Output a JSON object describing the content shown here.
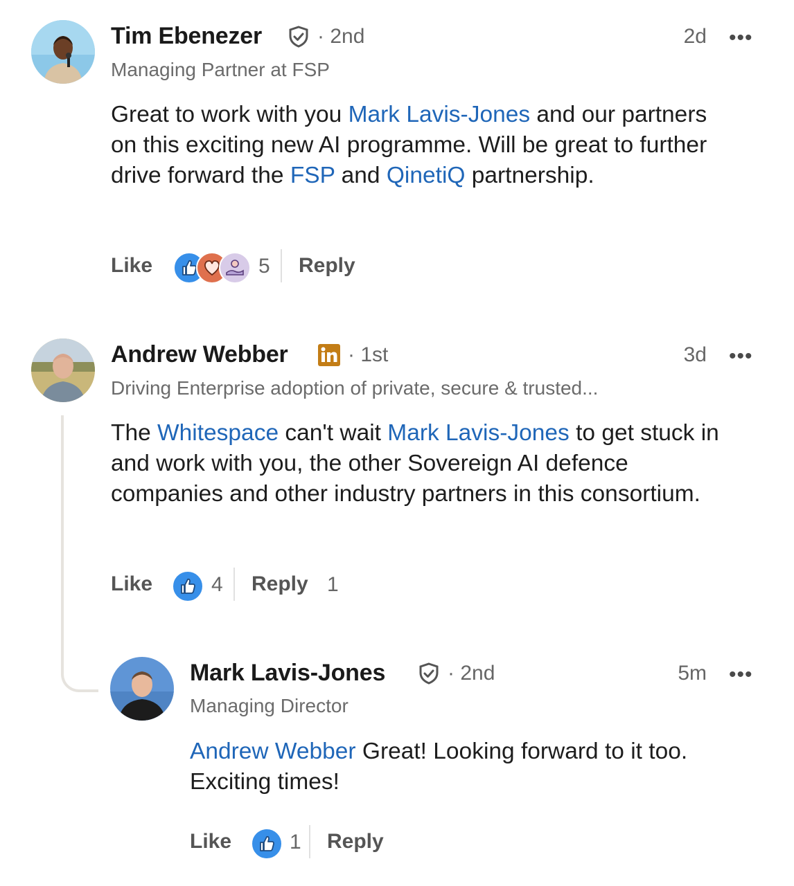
{
  "comments": [
    {
      "author": "Tim Ebenezer",
      "badge": "verified-shield-icon",
      "degree": "· 2nd",
      "headline": "Managing Partner at FSP",
      "time": "2d",
      "more": "•••",
      "body": [
        {
          "t": "Great to work with you "
        },
        {
          "t": "Mark Lavis-Jones",
          "m": true
        },
        {
          "t": " and our partners on this exciting new AI programme. Will be great to further drive forward the "
        },
        {
          "t": "FSP",
          "m": true
        },
        {
          "t": " and "
        },
        {
          "t": "QinetiQ",
          "m": true
        },
        {
          "t": " partnership."
        }
      ],
      "like_label": "Like",
      "reactions": [
        "like-reaction-icon",
        "love-reaction-icon",
        "support-reaction-icon"
      ],
      "reaction_count": "5",
      "reply_label": "Reply",
      "reply_count": ""
    },
    {
      "author": "Andrew Webber",
      "badge": "linkedin-premium-icon",
      "degree": "· 1st",
      "headline": "Driving Enterprise adoption of private, secure & trusted...",
      "time": "3d",
      "more": "•••",
      "body": [
        {
          "t": "The "
        },
        {
          "t": "Whitespace",
          "m": true
        },
        {
          "t": " can't wait "
        },
        {
          "t": "Mark Lavis-Jones",
          "m": true
        },
        {
          "t": " to get stuck in and work with you, the other Sovereign AI defence companies  and other industry partners in this consortium."
        }
      ],
      "like_label": "Like",
      "reactions": [
        "like-reaction-icon"
      ],
      "reaction_count": "4",
      "reply_label": "Reply",
      "reply_count": "1"
    },
    {
      "author": "Mark Lavis-Jones",
      "badge": "verified-shield-icon",
      "degree": "· 2nd",
      "headline": "Managing Director",
      "time": "5m",
      "more": "•••",
      "body": [
        {
          "t": "Andrew Webber",
          "m": true
        },
        {
          "t": " Great! Looking forward to it too. Exciting times!"
        }
      ],
      "like_label": "Like",
      "reactions": [
        "like-reaction-icon"
      ],
      "reaction_count": "1",
      "reply_label": "Reply",
      "reply_count": ""
    }
  ],
  "colors": {
    "mention": "#1f66b8",
    "like_blue": "#378fe9",
    "love_red": "#df704d",
    "support_purple": "#b5a2d6",
    "premium_gold": "#c37d16"
  }
}
